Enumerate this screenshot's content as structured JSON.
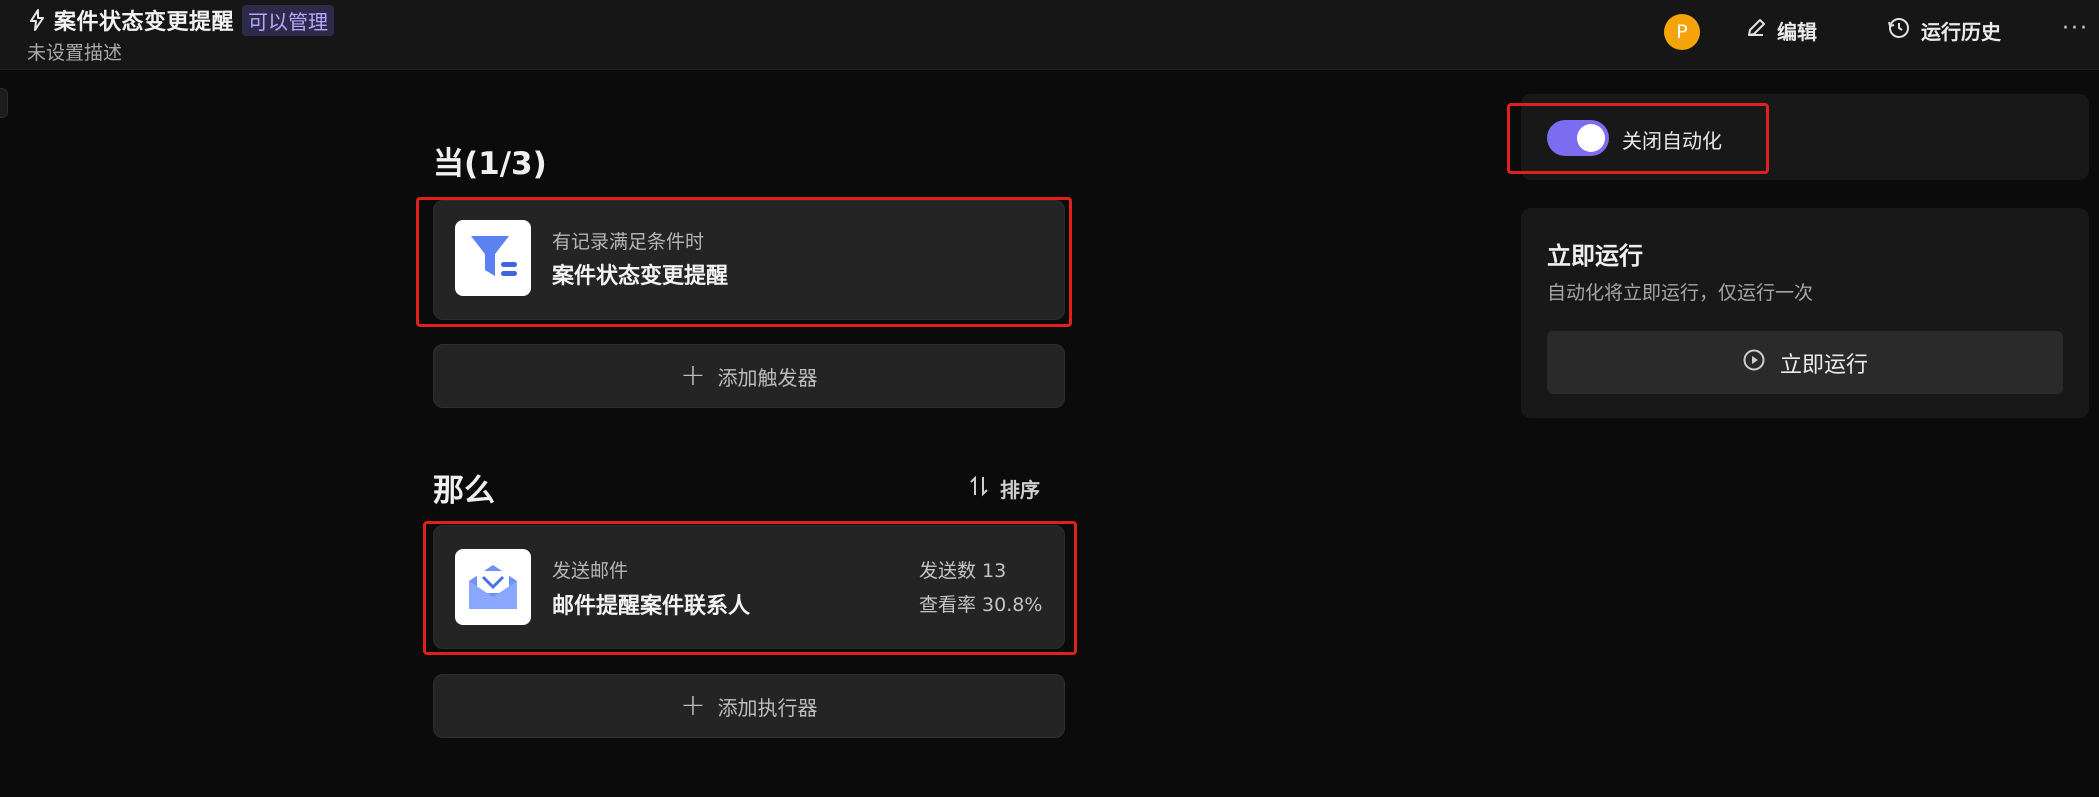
{
  "header": {
    "title": "案件状态变更提醒",
    "permission_badge": "可以管理",
    "description": "未设置描述",
    "avatar_letter": "P",
    "edit_label": "编辑",
    "history_label": "运行历史",
    "more_label": "···"
  },
  "when": {
    "title": "当(1/3)",
    "trigger": {
      "subtitle": "有记录满足条件时",
      "name": "案件状态变更提醒",
      "icon": "filter-icon"
    },
    "add_label": "添加触发器"
  },
  "then": {
    "title": "那么",
    "sort_label": "排序",
    "action": {
      "subtitle": "发送邮件",
      "name": "邮件提醒案件联系人",
      "icon": "mail-icon",
      "stat_sent": "发送数 13",
      "stat_view": "查看率 30.8%"
    },
    "add_label": "添加执行器"
  },
  "sidebar": {
    "toggle_label": "关闭自动化",
    "toggle_on": true,
    "run_title": "立即运行",
    "run_desc": "自动化将立即运行，仅运行一次",
    "run_button": "立即运行"
  },
  "colors": {
    "accent": "#7b6cf0",
    "highlight": "#e0211b",
    "avatar": "#f5a50a"
  }
}
